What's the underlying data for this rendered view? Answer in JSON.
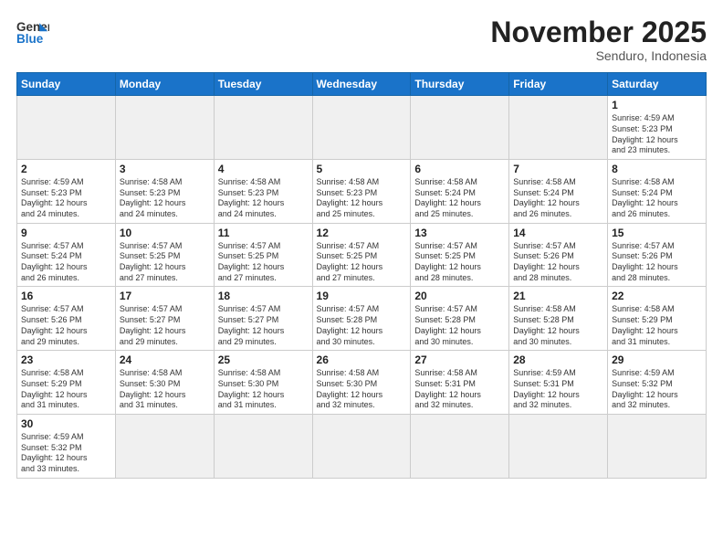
{
  "logo": {
    "line1": "General",
    "line2": "Blue"
  },
  "header": {
    "month": "November 2025",
    "location": "Senduro, Indonesia"
  },
  "weekdays": [
    "Sunday",
    "Monday",
    "Tuesday",
    "Wednesday",
    "Thursday",
    "Friday",
    "Saturday"
  ],
  "weeks": [
    [
      {
        "day": "",
        "info": ""
      },
      {
        "day": "",
        "info": ""
      },
      {
        "day": "",
        "info": ""
      },
      {
        "day": "",
        "info": ""
      },
      {
        "day": "",
        "info": ""
      },
      {
        "day": "",
        "info": ""
      },
      {
        "day": "1",
        "info": "Sunrise: 4:59 AM\nSunset: 5:23 PM\nDaylight: 12 hours\nand 23 minutes."
      }
    ],
    [
      {
        "day": "2",
        "info": "Sunrise: 4:59 AM\nSunset: 5:23 PM\nDaylight: 12 hours\nand 24 minutes."
      },
      {
        "day": "3",
        "info": "Sunrise: 4:58 AM\nSunset: 5:23 PM\nDaylight: 12 hours\nand 24 minutes."
      },
      {
        "day": "4",
        "info": "Sunrise: 4:58 AM\nSunset: 5:23 PM\nDaylight: 12 hours\nand 24 minutes."
      },
      {
        "day": "5",
        "info": "Sunrise: 4:58 AM\nSunset: 5:23 PM\nDaylight: 12 hours\nand 25 minutes."
      },
      {
        "day": "6",
        "info": "Sunrise: 4:58 AM\nSunset: 5:24 PM\nDaylight: 12 hours\nand 25 minutes."
      },
      {
        "day": "7",
        "info": "Sunrise: 4:58 AM\nSunset: 5:24 PM\nDaylight: 12 hours\nand 26 minutes."
      },
      {
        "day": "8",
        "info": "Sunrise: 4:58 AM\nSunset: 5:24 PM\nDaylight: 12 hours\nand 26 minutes."
      }
    ],
    [
      {
        "day": "9",
        "info": "Sunrise: 4:57 AM\nSunset: 5:24 PM\nDaylight: 12 hours\nand 26 minutes."
      },
      {
        "day": "10",
        "info": "Sunrise: 4:57 AM\nSunset: 5:25 PM\nDaylight: 12 hours\nand 27 minutes."
      },
      {
        "day": "11",
        "info": "Sunrise: 4:57 AM\nSunset: 5:25 PM\nDaylight: 12 hours\nand 27 minutes."
      },
      {
        "day": "12",
        "info": "Sunrise: 4:57 AM\nSunset: 5:25 PM\nDaylight: 12 hours\nand 27 minutes."
      },
      {
        "day": "13",
        "info": "Sunrise: 4:57 AM\nSunset: 5:25 PM\nDaylight: 12 hours\nand 28 minutes."
      },
      {
        "day": "14",
        "info": "Sunrise: 4:57 AM\nSunset: 5:26 PM\nDaylight: 12 hours\nand 28 minutes."
      },
      {
        "day": "15",
        "info": "Sunrise: 4:57 AM\nSunset: 5:26 PM\nDaylight: 12 hours\nand 28 minutes."
      }
    ],
    [
      {
        "day": "16",
        "info": "Sunrise: 4:57 AM\nSunset: 5:26 PM\nDaylight: 12 hours\nand 29 minutes."
      },
      {
        "day": "17",
        "info": "Sunrise: 4:57 AM\nSunset: 5:27 PM\nDaylight: 12 hours\nand 29 minutes."
      },
      {
        "day": "18",
        "info": "Sunrise: 4:57 AM\nSunset: 5:27 PM\nDaylight: 12 hours\nand 29 minutes."
      },
      {
        "day": "19",
        "info": "Sunrise: 4:57 AM\nSunset: 5:28 PM\nDaylight: 12 hours\nand 30 minutes."
      },
      {
        "day": "20",
        "info": "Sunrise: 4:57 AM\nSunset: 5:28 PM\nDaylight: 12 hours\nand 30 minutes."
      },
      {
        "day": "21",
        "info": "Sunrise: 4:58 AM\nSunset: 5:28 PM\nDaylight: 12 hours\nand 30 minutes."
      },
      {
        "day": "22",
        "info": "Sunrise: 4:58 AM\nSunset: 5:29 PM\nDaylight: 12 hours\nand 31 minutes."
      }
    ],
    [
      {
        "day": "23",
        "info": "Sunrise: 4:58 AM\nSunset: 5:29 PM\nDaylight: 12 hours\nand 31 minutes."
      },
      {
        "day": "24",
        "info": "Sunrise: 4:58 AM\nSunset: 5:30 PM\nDaylight: 12 hours\nand 31 minutes."
      },
      {
        "day": "25",
        "info": "Sunrise: 4:58 AM\nSunset: 5:30 PM\nDaylight: 12 hours\nand 31 minutes."
      },
      {
        "day": "26",
        "info": "Sunrise: 4:58 AM\nSunset: 5:30 PM\nDaylight: 12 hours\nand 32 minutes."
      },
      {
        "day": "27",
        "info": "Sunrise: 4:58 AM\nSunset: 5:31 PM\nDaylight: 12 hours\nand 32 minutes."
      },
      {
        "day": "28",
        "info": "Sunrise: 4:59 AM\nSunset: 5:31 PM\nDaylight: 12 hours\nand 32 minutes."
      },
      {
        "day": "29",
        "info": "Sunrise: 4:59 AM\nSunset: 5:32 PM\nDaylight: 12 hours\nand 32 minutes."
      }
    ],
    [
      {
        "day": "30",
        "info": "Sunrise: 4:59 AM\nSunset: 5:32 PM\nDaylight: 12 hours\nand 33 minutes."
      },
      {
        "day": "",
        "info": ""
      },
      {
        "day": "",
        "info": ""
      },
      {
        "day": "",
        "info": ""
      },
      {
        "day": "",
        "info": ""
      },
      {
        "day": "",
        "info": ""
      },
      {
        "day": "",
        "info": ""
      }
    ]
  ]
}
